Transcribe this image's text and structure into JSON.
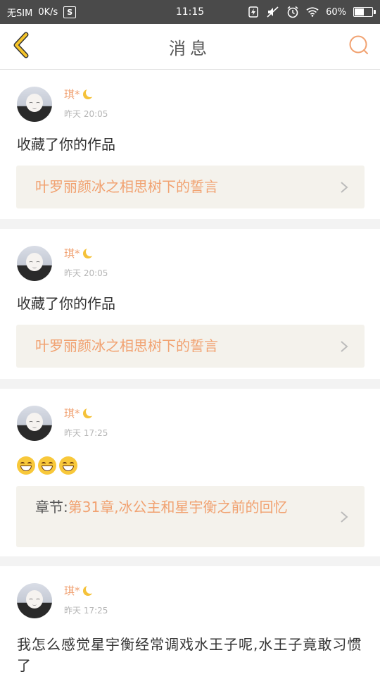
{
  "status_bar": {
    "carrier": "无SIM",
    "speed": "0K/s",
    "sim_icon_text": "S",
    "time": "11:15",
    "battery_percent": "60%",
    "battery_level": 0.6
  },
  "header": {
    "title": "消息",
    "back_icon": "chevron-left-icon",
    "search_icon": "search-icon",
    "accent_color": "#f5c42a",
    "search_color": "#f1a271"
  },
  "messages": [
    {
      "user": "琪*",
      "time": "昨天 20:05",
      "content": "收藏了你的作品",
      "ref_prefix": "",
      "ref_text": "叶罗丽颜冰之相思树下的誓言"
    },
    {
      "user": "琪*",
      "time": "昨天 20:05",
      "content": "收藏了你的作品",
      "ref_prefix": "",
      "ref_text": "叶罗丽颜冰之相思树下的誓言"
    },
    {
      "user": "琪*",
      "time": "昨天 17:25",
      "content": "",
      "emoji_count": 3,
      "ref_prefix": "章节:",
      "ref_text": "第31章,冰公主和星宇衡之前的回忆"
    },
    {
      "user": "琪*",
      "time": "昨天 17:25",
      "content": "我怎么感觉星宇衡经常调戏水王子呢,水王子竟敢习惯了",
      "ref_prefix": "",
      "ref_text": ""
    }
  ]
}
